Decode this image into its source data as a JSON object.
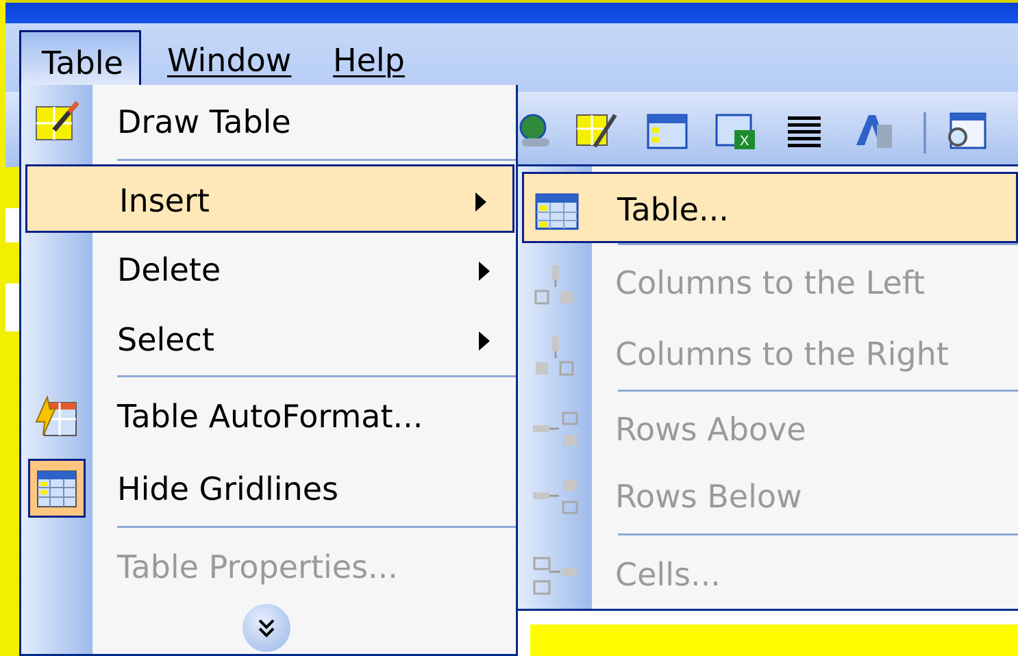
{
  "menubar": {
    "items": [
      {
        "label": "Table",
        "mnemonic_index": 0
      },
      {
        "label": "Window",
        "mnemonic_index": 0
      },
      {
        "label": "Help",
        "mnemonic_index": 0
      }
    ]
  },
  "toolbar": {
    "icons": [
      "web-tools-icon",
      "draw-table-icon",
      "insert-table-icon",
      "insert-excel-icon",
      "columns-icon",
      "drawing-icon",
      "document-map-icon"
    ]
  },
  "table_menu": {
    "items": [
      {
        "label": "Draw Table",
        "icon": "draw-table-icon",
        "enabled": true
      },
      {
        "label": "Insert",
        "submenu": true,
        "highlighted": true
      },
      {
        "label": "Delete",
        "submenu": true
      },
      {
        "label": "Select",
        "submenu": true
      },
      {
        "label": "Table AutoFormat...",
        "icon": "autoformat-icon"
      },
      {
        "label": "Hide Gridlines",
        "icon": "gridlines-icon",
        "checked": true
      },
      {
        "label": "Table Properties...",
        "enabled": false
      }
    ],
    "expand_icon": "chevron-double-down-icon"
  },
  "insert_submenu": {
    "items": [
      {
        "label": "Table...",
        "icon": "insert-table-icon",
        "highlighted": true
      },
      {
        "label": "Columns to the Left",
        "enabled": false
      },
      {
        "label": "Columns to the Right",
        "enabled": false
      },
      {
        "label": "Rows Above",
        "enabled": false
      },
      {
        "label": "Rows Below",
        "enabled": false
      },
      {
        "label": "Cells...",
        "enabled": false
      }
    ]
  },
  "colors": {
    "highlight": "#ffe8b8",
    "border": "#002a8a",
    "disabled_text": "#9a9a9a"
  }
}
